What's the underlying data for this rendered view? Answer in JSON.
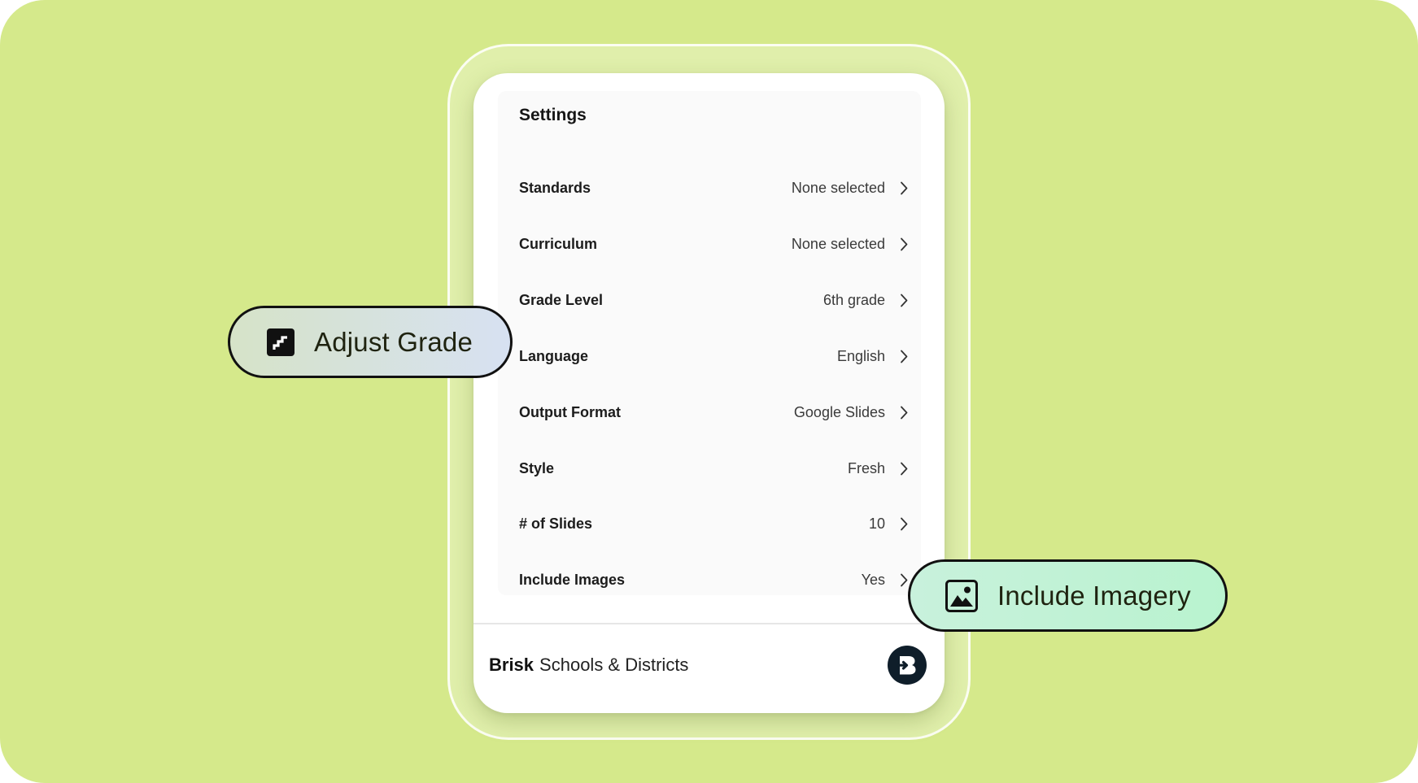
{
  "colors": {
    "background": "#d5e98b",
    "panel": "#ffffff",
    "logo_bg": "#0f1e2a",
    "grade_pill": "#d7e1f2",
    "imagery_pill": "#b9f3cf"
  },
  "settings": {
    "title": "Settings",
    "rows": [
      {
        "label": "Standards",
        "value": "None selected"
      },
      {
        "label": "Curriculum",
        "value": "None selected"
      },
      {
        "label": "Grade Level",
        "value": "6th grade"
      },
      {
        "label": "Language",
        "value": "English"
      },
      {
        "label": "Output Format",
        "value": "Google Slides"
      },
      {
        "label": "Style",
        "value": "Fresh"
      },
      {
        "label": "# of Slides",
        "value": "10"
      },
      {
        "label": "Include Images",
        "value": "Yes"
      }
    ]
  },
  "footer": {
    "brand": "Brisk",
    "rest": "Schools & Districts",
    "logo_icon": "brisk-b-icon"
  },
  "callouts": {
    "adjust_grade": {
      "label": "Adjust Grade",
      "icon": "stairs-icon"
    },
    "include_imagery": {
      "label": "Include Imagery",
      "icon": "image-icon"
    }
  }
}
